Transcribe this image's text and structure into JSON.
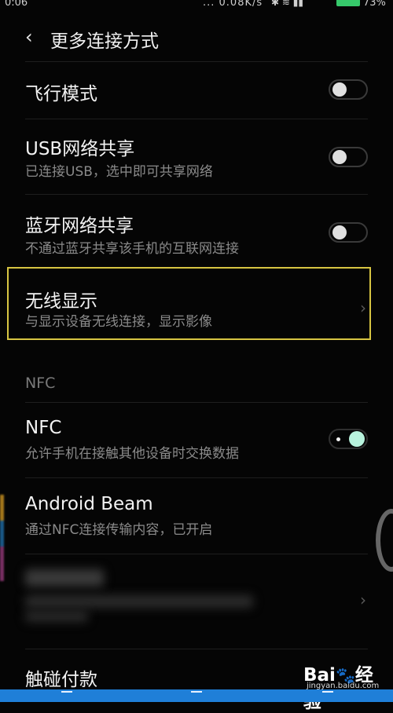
{
  "statusbar": {
    "time": "0:06",
    "net_speed": "... 0.08K/s",
    "signal_icons": "✱ ≋ ▮▮",
    "battery": "73%"
  },
  "header": {
    "back_icon": "‹",
    "title": "更多连接方式"
  },
  "rows": {
    "airplane": {
      "label": "飞行模式",
      "enabled": false
    },
    "usb": {
      "label": "USB网络共享",
      "subtitle": "已连接USB，选中即可共享网络",
      "enabled": false
    },
    "bt": {
      "label": "蓝牙网络共享",
      "subtitle": "不通过蓝牙共享该手机的互联网连接",
      "enabled": false
    },
    "wireless_display": {
      "label": "无线显示",
      "subtitle": "与显示设备无线连接，显示影像"
    },
    "nfc": {
      "label": "NFC",
      "subtitle": "允许手机在接触其他设备时交换数据",
      "enabled": true
    },
    "beam": {
      "label": "Android Beam",
      "subtitle": "通过NFC连接传输内容，已开启"
    },
    "touch_pay": {
      "label": "触碰付款"
    }
  },
  "sections": {
    "nfc_header": "NFC"
  },
  "watermark": {
    "logo": "Bai",
    "logo_tail": "经验",
    "url": "jingyan.baidu.com"
  },
  "colors": {
    "background": "#050505",
    "highlight": "#d7c542",
    "toggle_on": "#b8f3dd",
    "navbar": "#1f7fd8"
  }
}
